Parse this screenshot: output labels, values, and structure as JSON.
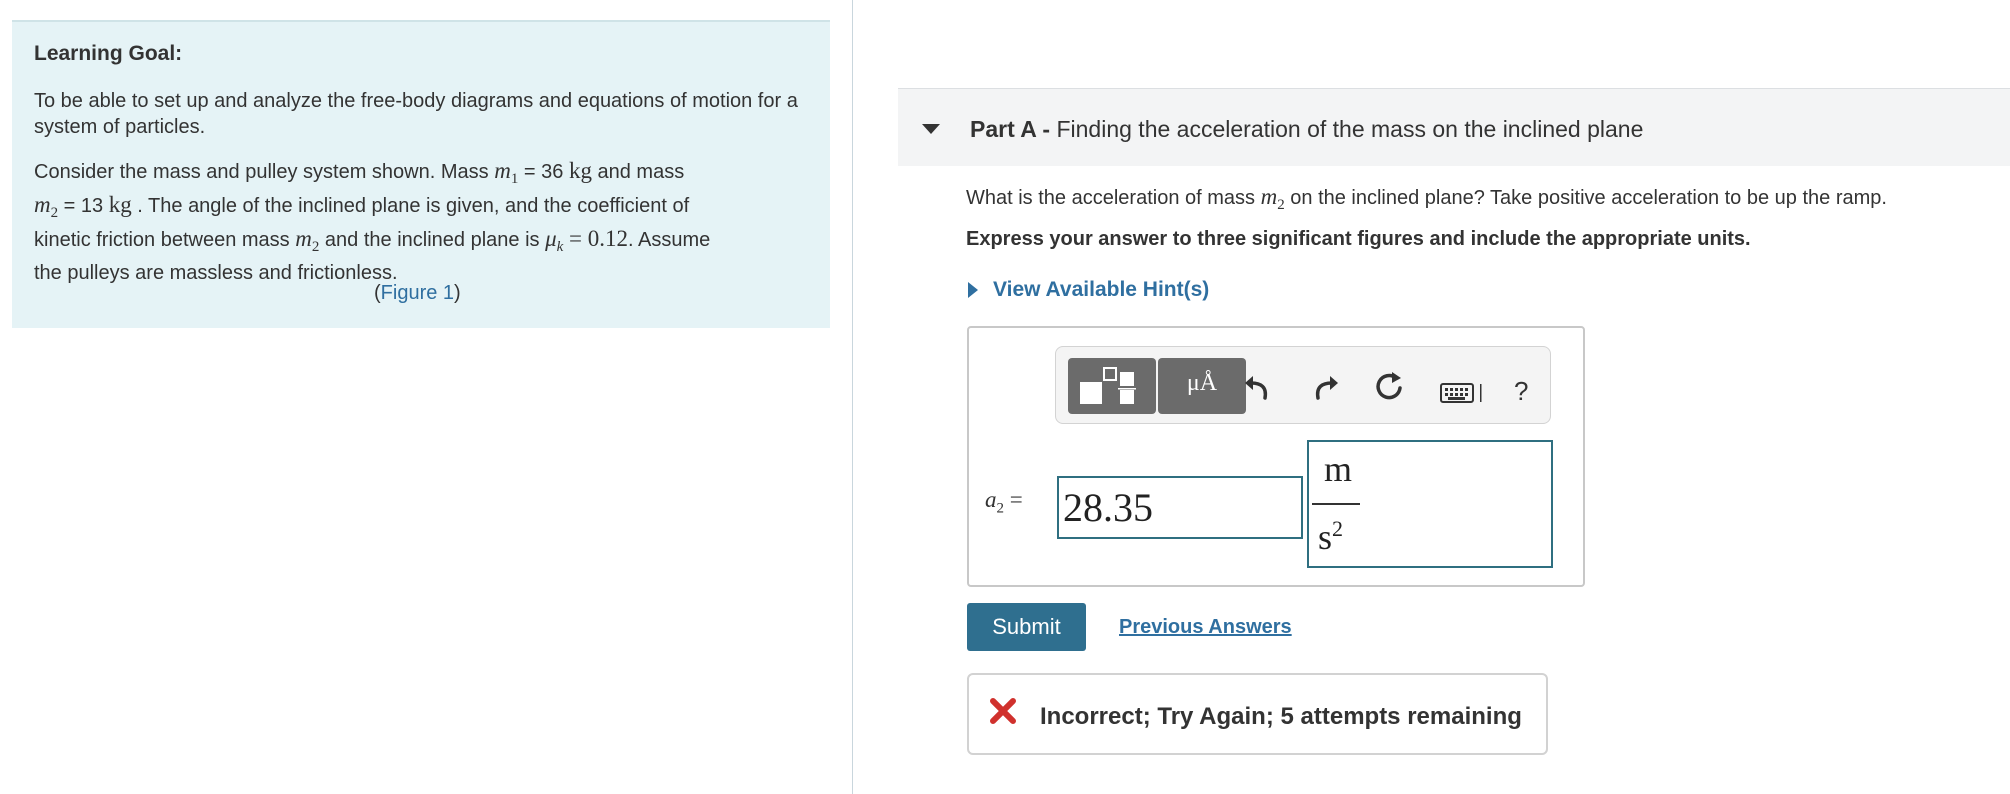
{
  "learning_goal": {
    "title": "Learning Goal:",
    "goal_text": "To be able to set up and analyze the free-body diagrams and equations of motion for a system of particles.",
    "p2_a": "Consider the mass and pulley system shown. Mass ",
    "m1_sym": "m",
    "m1_sub": "1",
    "m1_val": " = 36 ",
    "kg": "kg",
    "p2_b": " and mass",
    "m2_sym": "m",
    "m2_sub": "2",
    "m2_val": " = 13 ",
    "p2_c": " . The angle of the inclined plane is given, and the coefficient of",
    "p2_d": "kinetic friction between mass ",
    "p2_e": " and the inclined plane is ",
    "mu_sym": "μ",
    "mu_sub": "k",
    "mu_eq": " = 0.12",
    "p2_f": ". Assume",
    "p2_g": "the pulleys are massless and frictionless.",
    "figure_open": "(",
    "figure_link": "Figure 1",
    "figure_close": ")"
  },
  "part": {
    "label": "Part A - ",
    "title": "Finding the acceleration of the mass on the inclined plane",
    "question_a": "What is the acceleration of mass ",
    "question_sym": "m",
    "question_sub": "2",
    "question_b": " on the inclined plane? Take positive acceleration to be up the ramp.",
    "instruction": "Express your answer to three significant figures and include the appropriate units.",
    "hint_link": "View Available Hint(s)"
  },
  "toolbar": {
    "templates_icon": "templates-icon",
    "units_button": "μÅ",
    "undo_icon": "undo-icon",
    "redo_icon": "redo-icon",
    "reset_icon": "reset-icon",
    "keyboard_icon": "keyboard-icon",
    "help": "?"
  },
  "answer": {
    "var_sym": "a",
    "var_sub": "2",
    "equals": " =",
    "value": "28.35",
    "unit_numerator": "m",
    "unit_denominator": "s",
    "unit_exponent": "2"
  },
  "actions": {
    "submit": "Submit",
    "previous_answers": "Previous Answers"
  },
  "feedback": {
    "text": "Incorrect; Try Again; 5 attempts remaining",
    "icon": "incorrect-x-icon",
    "icon_color": "#d0312d"
  },
  "colors": {
    "panel_bg": "#e5f3f6",
    "link": "#2f6fa0",
    "submit_bg": "#2f6f8f",
    "input_border": "#2f6f80"
  }
}
